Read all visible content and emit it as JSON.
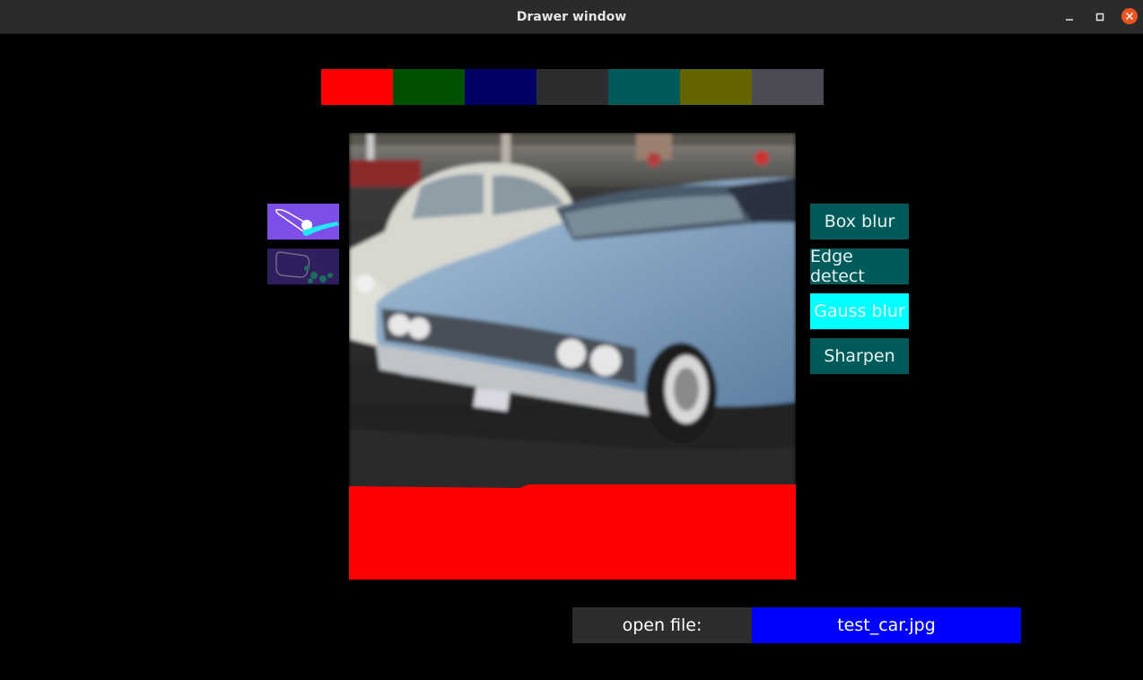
{
  "window": {
    "title": "Drawer window"
  },
  "palette": [
    {
      "name": "red",
      "color": "#ff0000"
    },
    {
      "name": "dark-green",
      "color": "#005000"
    },
    {
      "name": "navy",
      "color": "#000064"
    },
    {
      "name": "dark-gray",
      "color": "#2d2d2d"
    },
    {
      "name": "teal",
      "color": "#005a5a"
    },
    {
      "name": "olive",
      "color": "#646400"
    },
    {
      "name": "slate-gray",
      "color": "#4b4b55"
    }
  ],
  "tools": [
    {
      "name": "brush-icon",
      "active": true
    },
    {
      "name": "paint-bucket-icon",
      "active": false
    }
  ],
  "filters": [
    {
      "label": "Box blur",
      "active": false
    },
    {
      "label": "Edge detect",
      "active": false
    },
    {
      "label": "Gauss blur",
      "active": true
    },
    {
      "label": "Sharpen",
      "active": false
    }
  ],
  "file": {
    "label": "open file:",
    "name": "test_car.jpg"
  },
  "colors": {
    "accent_active": "#00ffff",
    "button_bg": "#005a5a",
    "file_bg": "#0000ff"
  }
}
